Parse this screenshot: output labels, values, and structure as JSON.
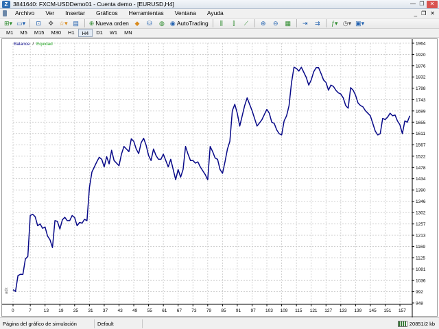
{
  "window": {
    "title": "3841640: FXCM-USDDemo01 - Cuenta demo - [EURUSD,H4]",
    "app_icon": "Z",
    "controls": [
      "—",
      "❐",
      "✕"
    ]
  },
  "menubar": {
    "items": [
      "Archivo",
      "Ver",
      "Insertar",
      "Gráficos",
      "Herramientas",
      "Ventana",
      "Ayuda"
    ],
    "right_controls": [
      "_",
      "❐",
      "✕"
    ]
  },
  "toolbar": {
    "new_order_label": "Nueva orden",
    "autotrading_label": "AutoTrading"
  },
  "periods": {
    "items": [
      "M1",
      "M5",
      "M15",
      "M30",
      "H1",
      "H4",
      "D1",
      "W1",
      "MN"
    ],
    "active": "H4"
  },
  "chart": {
    "legend_balance": "Balance",
    "legend_separator": "/",
    "legend_equity": "Equidad",
    "vertical_label": "adx",
    "colors": {
      "balance": "#0a0a8a",
      "equity": "#22a622",
      "grid": "#c8c8c8",
      "axis_text": "#000000"
    }
  },
  "chart_data": {
    "type": "line",
    "title": "",
    "series": [
      {
        "name": "Balance",
        "x": [
          0,
          1,
          2,
          3,
          4,
          5,
          6,
          7,
          8,
          9,
          10,
          11,
          12,
          13,
          14,
          15,
          16,
          17,
          18,
          19,
          20,
          21,
          22,
          23,
          24,
          25,
          26,
          27,
          28,
          29,
          30,
          31,
          32,
          33,
          34,
          35,
          36,
          37,
          38,
          39,
          40,
          41,
          42,
          43,
          44,
          45,
          46,
          47,
          48,
          49,
          50,
          51,
          52,
          53,
          54,
          55,
          56,
          57,
          58,
          59,
          60,
          61,
          62,
          63,
          64,
          65,
          66,
          67,
          68,
          69,
          70,
          71,
          72,
          73,
          74,
          75,
          76,
          77,
          78,
          79,
          80,
          81,
          82,
          83,
          84,
          85,
          86,
          87,
          88,
          89,
          90,
          91,
          92,
          93,
          94,
          95,
          96,
          97,
          98,
          99,
          100,
          101,
          102,
          103,
          104,
          105,
          106,
          107,
          108,
          109,
          110,
          111,
          112,
          113,
          114,
          115,
          116,
          117,
          118,
          119,
          120,
          121,
          122,
          123,
          124,
          125,
          126,
          127,
          128,
          129,
          130,
          131,
          132,
          133,
          134,
          135,
          136,
          137,
          138,
          139,
          140,
          141,
          142,
          143,
          144,
          145,
          146,
          147,
          148,
          149,
          150,
          151,
          152,
          153,
          154,
          155,
          156,
          157,
          158,
          159,
          160,
          161
        ],
        "values": [
          1000,
          993,
          1055,
          1060,
          1060,
          1120,
          1130,
          1290,
          1295,
          1285,
          1250,
          1257,
          1240,
          1245,
          1210,
          1195,
          1165,
          1270,
          1267,
          1237,
          1273,
          1283,
          1270,
          1270,
          1290,
          1282,
          1250,
          1263,
          1260,
          1275,
          1270,
          1400,
          1460,
          1480,
          1500,
          1518,
          1510,
          1480,
          1520,
          1492,
          1545,
          1505,
          1495,
          1485,
          1530,
          1560,
          1550,
          1540,
          1590,
          1580,
          1550,
          1532,
          1575,
          1592,
          1565,
          1525,
          1505,
          1550,
          1525,
          1510,
          1510,
          1530,
          1505,
          1480,
          1510,
          1470,
          1430,
          1470,
          1440,
          1470,
          1560,
          1530,
          1505,
          1505,
          1495,
          1500,
          1480,
          1465,
          1450,
          1430,
          1560,
          1540,
          1515,
          1510,
          1470,
          1455,
          1500,
          1550,
          1580,
          1700,
          1725,
          1690,
          1640,
          1680,
          1720,
          1750,
          1725,
          1700,
          1670,
          1640,
          1652,
          1665,
          1685,
          1705,
          1690,
          1655,
          1650,
          1625,
          1610,
          1605,
          1660,
          1680,
          1720,
          1810,
          1870,
          1865,
          1855,
          1870,
          1850,
          1830,
          1800,
          1820,
          1852,
          1868,
          1868,
          1845,
          1820,
          1810,
          1780,
          1800,
          1795,
          1780,
          1770,
          1765,
          1750,
          1720,
          1710,
          1790,
          1780,
          1760,
          1730,
          1720,
          1715,
          1700,
          1690,
          1680,
          1650,
          1620,
          1605,
          1610,
          1670,
          1665,
          1675,
          1690,
          1680,
          1683,
          1660,
          1645,
          1610,
          1660,
          1655,
          1680
        ]
      },
      {
        "name": "Equidad",
        "x": [
          0,
          1,
          2,
          3,
          4,
          5,
          6,
          7,
          8,
          9,
          10,
          11,
          12,
          13,
          14,
          15,
          16,
          17,
          18,
          19,
          20,
          21,
          22,
          23,
          24,
          25,
          26,
          27,
          28,
          29,
          30,
          31,
          32,
          33,
          34,
          35,
          36,
          37,
          38,
          39,
          40,
          41,
          42,
          43,
          44,
          45,
          46,
          47,
          48,
          49,
          50,
          51,
          52,
          53,
          54,
          55,
          56,
          57,
          58,
          59,
          60,
          61,
          62,
          63,
          64,
          65,
          66,
          67,
          68,
          69,
          70,
          71,
          72,
          73,
          74,
          75,
          76,
          77,
          78,
          79,
          80,
          81,
          82,
          83,
          84,
          85,
          86,
          87,
          88,
          89,
          90,
          91,
          92,
          93,
          94,
          95,
          96,
          97,
          98,
          99,
          100,
          101,
          102,
          103,
          104,
          105,
          106,
          107,
          108,
          109,
          110,
          111,
          112,
          113,
          114,
          115,
          116,
          117,
          118,
          119,
          120,
          121,
          122,
          123,
          124,
          125,
          126,
          127,
          128,
          129,
          130,
          131,
          132,
          133,
          134,
          135,
          136,
          137,
          138,
          139,
          140,
          141,
          142,
          143,
          144,
          145,
          146,
          147,
          148,
          149,
          150,
          151,
          152,
          153,
          154,
          155,
          156,
          157,
          158,
          159,
          160,
          161
        ],
        "values": [
          1000,
          993,
          1055,
          1060,
          1060,
          1120,
          1130,
          1290,
          1295,
          1285,
          1250,
          1257,
          1240,
          1245,
          1210,
          1195,
          1165,
          1270,
          1267,
          1237,
          1273,
          1283,
          1270,
          1270,
          1290,
          1282,
          1250,
          1263,
          1260,
          1275,
          1270,
          1400,
          1460,
          1480,
          1500,
          1518,
          1510,
          1480,
          1520,
          1492,
          1545,
          1505,
          1495,
          1485,
          1530,
          1560,
          1550,
          1540,
          1590,
          1580,
          1550,
          1532,
          1575,
          1592,
          1565,
          1525,
          1505,
          1550,
          1525,
          1510,
          1510,
          1530,
          1505,
          1480,
          1510,
          1470,
          1430,
          1470,
          1440,
          1470,
          1560,
          1530,
          1505,
          1505,
          1495,
          1500,
          1480,
          1465,
          1450,
          1430,
          1560,
          1540,
          1515,
          1510,
          1470,
          1455,
          1500,
          1550,
          1580,
          1700,
          1725,
          1690,
          1640,
          1680,
          1720,
          1750,
          1725,
          1700,
          1670,
          1640,
          1652,
          1665,
          1685,
          1705,
          1690,
          1655,
          1650,
          1625,
          1610,
          1605,
          1660,
          1680,
          1720,
          1810,
          1870,
          1865,
          1855,
          1870,
          1850,
          1830,
          1800,
          1820,
          1852,
          1868,
          1868,
          1845,
          1820,
          1810,
          1780,
          1800,
          1795,
          1780,
          1770,
          1765,
          1750,
          1720,
          1710,
          1790,
          1780,
          1760,
          1730,
          1720,
          1715,
          1700,
          1690,
          1680,
          1650,
          1620,
          1605,
          1610,
          1670,
          1665,
          1675,
          1690,
          1680,
          1683,
          1660,
          1645,
          1610,
          1660,
          1655,
          1680
        ]
      }
    ],
    "x_ticks": [
      0,
      7,
      13,
      19,
      25,
      31,
      37,
      43,
      49,
      55,
      61,
      67,
      73,
      79,
      85,
      91,
      97,
      103,
      109,
      115,
      121,
      127,
      133,
      139,
      145,
      151,
      157
    ],
    "y_ticks": [
      948,
      992,
      1036,
      1081,
      1125,
      1169,
      1213,
      1257,
      1302,
      1346,
      1390,
      1434,
      1478,
      1522,
      1567,
      1611,
      1655,
      1699,
      1743,
      1788,
      1832,
      1876,
      1920,
      1964
    ],
    "xlim": [
      0,
      162
    ],
    "ylim": [
      948,
      1964
    ],
    "grid": true,
    "legend_placement": "top-left"
  },
  "statusbar": {
    "main_text": "Página del gráfico de simulación",
    "profile": "Default",
    "traffic": "20851/2 kb"
  }
}
